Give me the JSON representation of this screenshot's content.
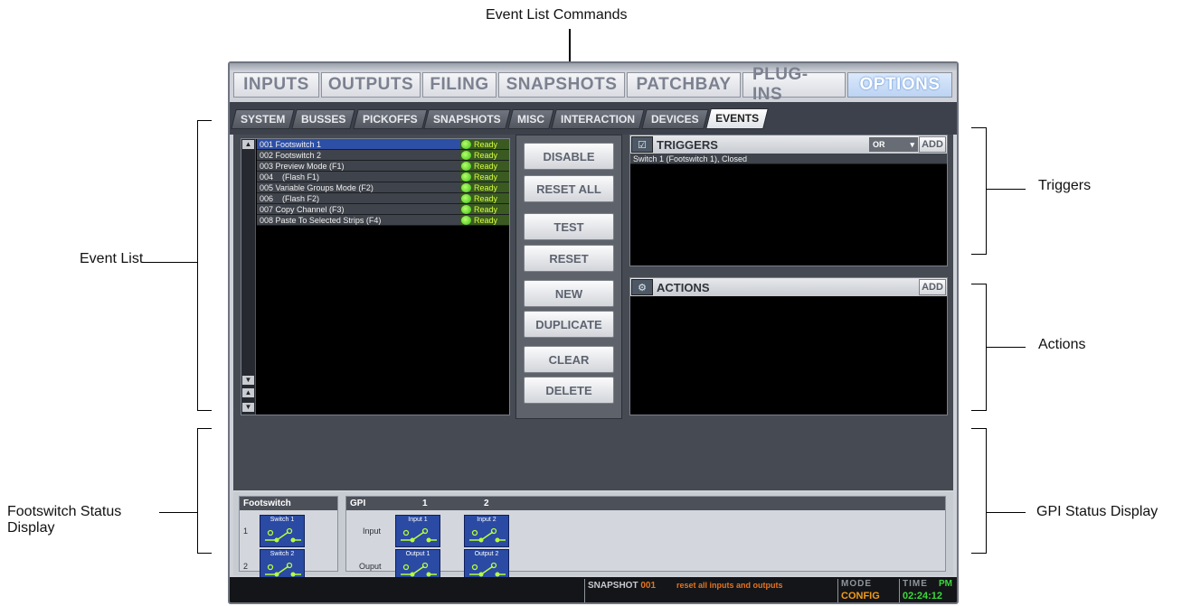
{
  "callouts": {
    "event_list_commands": "Event List Commands",
    "triggers": "Triggers",
    "event_list": "Event List",
    "actions": "Actions",
    "footswitch_status_line1": "Footswitch Status",
    "footswitch_status_line2": "Display",
    "gpi_status": "GPI Status Display"
  },
  "main_tabs": [
    "INPUTS",
    "OUTPUTS",
    "FILING",
    "SNAPSHOTS",
    "PATCHBAY",
    "PLUG-INS",
    "OPTIONS"
  ],
  "active_main_tab": "OPTIONS",
  "sub_tabs": [
    "SYSTEM",
    "BUSSES",
    "PICKOFFS",
    "SNAPSHOTS",
    "MISC",
    "INTERACTION",
    "DEVICES",
    "EVENTS"
  ],
  "active_sub_tab": "EVENTS",
  "events": [
    {
      "name": "001 Footswitch 1",
      "status": "Ready"
    },
    {
      "name": "002 Footswitch 2",
      "status": "Ready"
    },
    {
      "name": "003 Preview Mode (F1)",
      "status": "Ready"
    },
    {
      "name": "004    (Flash F1)",
      "status": "Ready"
    },
    {
      "name": "005 Variable Groups Mode (F2)",
      "status": "Ready"
    },
    {
      "name": "006    (Flash F2)",
      "status": "Ready"
    },
    {
      "name": "007 Copy Channel (F3)",
      "status": "Ready"
    },
    {
      "name": "008 Paste To Selected Strips (F4)",
      "status": "Ready"
    }
  ],
  "commands": {
    "disable": "DISABLE",
    "reset_all": "RESET ALL",
    "test": "TEST",
    "reset": "RESET",
    "new": "NEW",
    "duplicate": "DUPLICATE",
    "clear": "CLEAR",
    "delete": "DELETE"
  },
  "triggers": {
    "title": "TRIGGERS",
    "logic": "OR",
    "add_label": "ADD",
    "items": [
      "Switch 1 (Footswitch 1), Closed"
    ]
  },
  "actions": {
    "title": "ACTIONS",
    "add_label": "ADD"
  },
  "footswitch": {
    "title": "Footswitch",
    "rows": [
      {
        "num": "1",
        "label": "Switch 1"
      },
      {
        "num": "2",
        "label": "Switch 2"
      }
    ]
  },
  "gpi": {
    "title": "GPI",
    "columns": [
      "1",
      "2"
    ],
    "input_row_label": "Input",
    "output_row_label": "Ouput",
    "inputs": [
      "Input 1",
      "Input 2"
    ],
    "outputs": [
      "Output 1",
      "Output 2"
    ]
  },
  "status_bar": {
    "snapshot_label": "SNAPSHOT",
    "snapshot_number": "001",
    "snapshot_text": "reset all inputs and outputs",
    "mode_label": "MODE",
    "mode_value": "CONFIG",
    "time_label": "TIME",
    "time_period": "PM",
    "time_value": "02:24:12"
  },
  "colors": {
    "selected_row": "#2d4fa6",
    "ready_led": "#3bbf14",
    "ready_text": "#d8ff3a",
    "active_tab": "#bcd3f3",
    "snapshot_text": "#e5731f",
    "time_text": "#3bd93b"
  },
  "icons": {
    "triggers": "trigger-icon",
    "actions": "action-icon",
    "switch_open": "switch-open-icon",
    "dropdown": "chevron-down-icon",
    "scroll_up": "arrow-up-icon",
    "scroll_down": "arrow-down-icon"
  }
}
